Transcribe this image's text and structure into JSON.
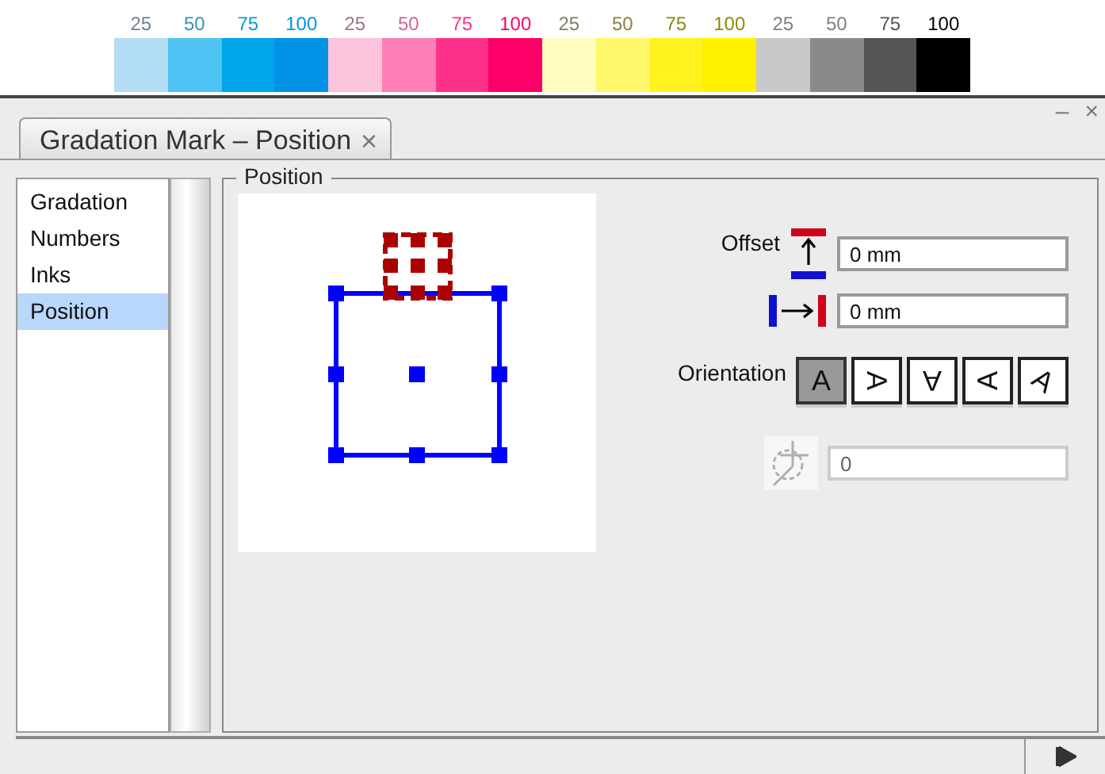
{
  "swatches": [
    {
      "label": "25",
      "color": "#b3def5"
    },
    {
      "label": "50",
      "color": "#4fc3f3"
    },
    {
      "label": "75",
      "color": "#00a6ea"
    },
    {
      "label": "100",
      "color": "#0092e6"
    },
    {
      "label": "25",
      "color": "#fcc3dc"
    },
    {
      "label": "50",
      "color": "#fd7fb6"
    },
    {
      "label": "75",
      "color": "#fd3189"
    },
    {
      "label": "100",
      "color": "#fc0068"
    },
    {
      "label": "25",
      "color": "#fffcc0"
    },
    {
      "label": "50",
      "color": "#fff76a"
    },
    {
      "label": "75",
      "color": "#fff21e"
    },
    {
      "label": "100",
      "color": "#fff100"
    },
    {
      "label": "25",
      "color": "#c8c8c8"
    },
    {
      "label": "50",
      "color": "#8a8a8a"
    },
    {
      "label": "75",
      "color": "#555555"
    },
    {
      "label": "100",
      "color": "#000000"
    }
  ],
  "panel": {
    "tab": {
      "title": "Gradation Mark – Position",
      "close": "×"
    },
    "window_controls": [
      "–",
      "×"
    ]
  },
  "sidebar": {
    "items": [
      {
        "label": "Gradation",
        "selected": false
      },
      {
        "label": "Numbers",
        "selected": false
      },
      {
        "label": "Inks",
        "selected": false
      },
      {
        "label": "Position",
        "selected": true
      }
    ]
  },
  "position": {
    "title": "Position",
    "offset_label": "Offset",
    "offsets": [
      {
        "kind": "vertical",
        "value": "0 mm"
      },
      {
        "kind": "horizontal",
        "value": "0 mm"
      }
    ],
    "orientation_label": "Orientation",
    "orientations": [
      {
        "glyph": "A",
        "kind": "up",
        "selected": true
      },
      {
        "glyph": "A",
        "kind": "right",
        "selected": false
      },
      {
        "glyph": "A",
        "kind": "down",
        "selected": false
      },
      {
        "glyph": "A",
        "kind": "left",
        "selected": false
      },
      {
        "glyph": "A",
        "kind": "tilted",
        "selected": false
      }
    ],
    "rotation": {
      "value": "0",
      "disabled": true
    }
  }
}
